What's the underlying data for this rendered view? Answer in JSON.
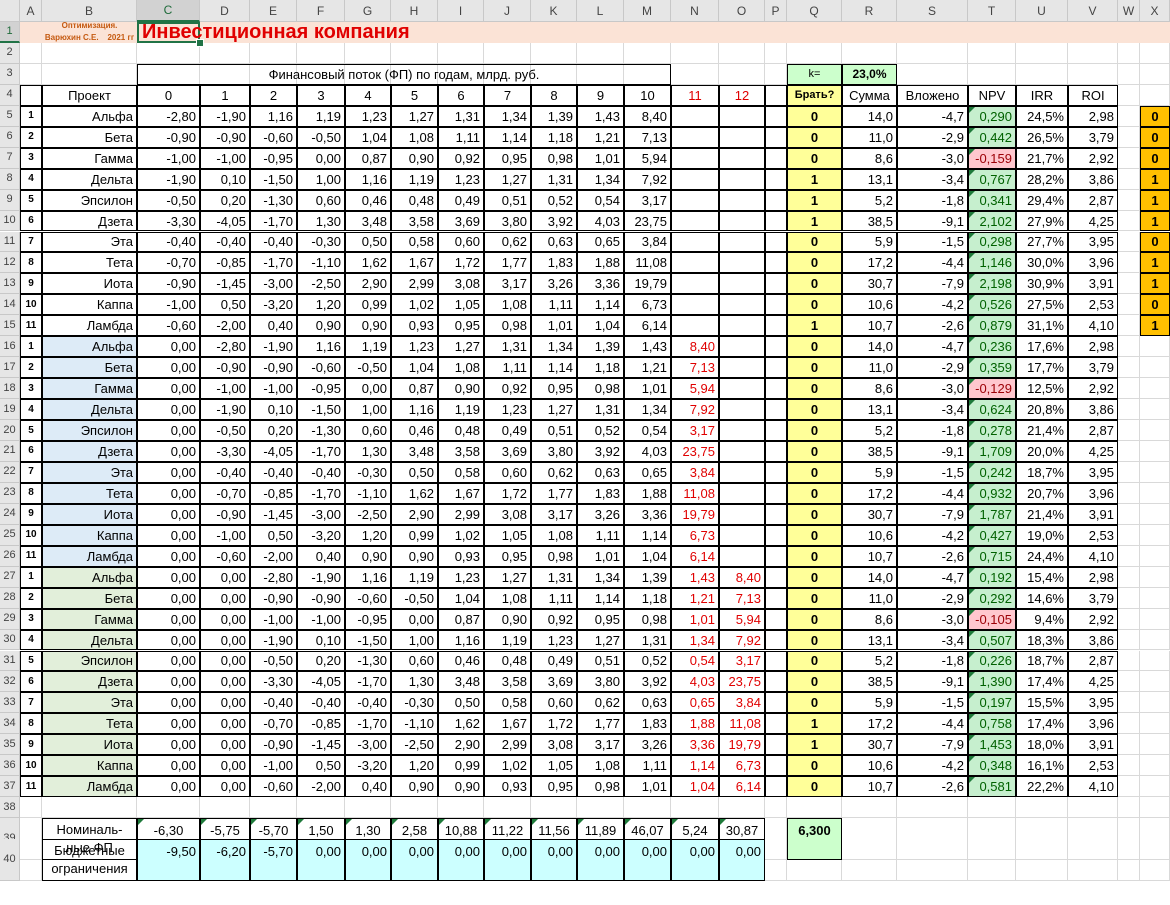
{
  "header": {
    "topleft_line1": "Оптимизация.",
    "topleft_line2": "Варюхин С.Е.    2021 гг",
    "title": "Инвестиционная компания",
    "flow_title": "Финансовый поток (ФП) по годам, млрд. руб.",
    "k_label": "k=",
    "k_value": "23,0%"
  },
  "column_letters": [
    "A",
    "B",
    "C",
    "D",
    "E",
    "F",
    "G",
    "H",
    "I",
    "J",
    "K",
    "L",
    "M",
    "N",
    "O",
    "P",
    "Q",
    "R",
    "S",
    "T",
    "U",
    "V",
    "W",
    "X"
  ],
  "row_numbers": [
    "1",
    "2",
    "3",
    "4",
    "5",
    "6",
    "7",
    "8",
    "9",
    "10",
    "11",
    "12",
    "13",
    "14",
    "15",
    "16",
    "17",
    "18",
    "19",
    "20",
    "21",
    "22",
    "23",
    "24",
    "25",
    "26",
    "27",
    "28",
    "29",
    "30",
    "31",
    "32",
    "33",
    "34",
    "35",
    "36",
    "37",
    "38",
    "39",
    "40"
  ],
  "table_header": {
    "project": "Проект",
    "years": [
      "0",
      "1",
      "2",
      "3",
      "4",
      "5",
      "6",
      "7",
      "8",
      "9",
      "10",
      "11",
      "12"
    ],
    "take": "Брать?",
    "sum": "Сумма",
    "invested": "Вложено",
    "npv": "NPV",
    "irr": "IRR",
    "roi": "ROI"
  },
  "rows": [
    {
      "n": "1",
      "p": "Альфа",
      "v": [
        "-2,80",
        "-1,90",
        "1,16",
        "1,19",
        "1,23",
        "1,27",
        "1,31",
        "1,34",
        "1,39",
        "1,43",
        "8,40",
        "",
        ""
      ],
      "take": "0",
      "sum": "14,0",
      "inv": "-4,7",
      "npv": "0,290",
      "irr": "24,5%",
      "roi": "2,98",
      "x": "0"
    },
    {
      "n": "2",
      "p": "Бета",
      "v": [
        "-0,90",
        "-0,90",
        "-0,60",
        "-0,50",
        "1,04",
        "1,08",
        "1,11",
        "1,14",
        "1,18",
        "1,21",
        "7,13",
        "",
        ""
      ],
      "take": "0",
      "sum": "11,0",
      "inv": "-2,9",
      "npv": "0,442",
      "irr": "26,5%",
      "roi": "3,79",
      "x": "0"
    },
    {
      "n": "3",
      "p": "Гамма",
      "v": [
        "-1,00",
        "-1,00",
        "-0,95",
        "0,00",
        "0,87",
        "0,90",
        "0,92",
        "0,95",
        "0,98",
        "1,01",
        "5,94",
        "",
        ""
      ],
      "take": "0",
      "sum": "8,6",
      "inv": "-3,0",
      "npv": "-0,159",
      "irr": "21,7%",
      "roi": "2,92",
      "x": "0"
    },
    {
      "n": "4",
      "p": "Дельта",
      "v": [
        "-1,90",
        "0,10",
        "-1,50",
        "1,00",
        "1,16",
        "1,19",
        "1,23",
        "1,27",
        "1,31",
        "1,34",
        "7,92",
        "",
        ""
      ],
      "take": "1",
      "sum": "13,1",
      "inv": "-3,4",
      "npv": "0,767",
      "irr": "28,2%",
      "roi": "3,86",
      "x": "1"
    },
    {
      "n": "5",
      "p": "Эпсилон",
      "v": [
        "-0,50",
        "0,20",
        "-1,30",
        "0,60",
        "0,46",
        "0,48",
        "0,49",
        "0,51",
        "0,52",
        "0,54",
        "3,17",
        "",
        ""
      ],
      "take": "1",
      "sum": "5,2",
      "inv": "-1,8",
      "npv": "0,341",
      "irr": "29,4%",
      "roi": "2,87",
      "x": "1"
    },
    {
      "n": "6",
      "p": "Дзета",
      "v": [
        "-3,30",
        "-4,05",
        "-1,70",
        "1,30",
        "3,48",
        "3,58",
        "3,69",
        "3,80",
        "3,92",
        "4,03",
        "23,75",
        "",
        ""
      ],
      "take": "1",
      "sum": "38,5",
      "inv": "-9,1",
      "npv": "2,102",
      "irr": "27,9%",
      "roi": "4,25",
      "x": "1"
    },
    {
      "n": "7",
      "p": "Эта",
      "v": [
        "-0,40",
        "-0,40",
        "-0,40",
        "-0,30",
        "0,50",
        "0,58",
        "0,60",
        "0,62",
        "0,63",
        "0,65",
        "3,84",
        "",
        ""
      ],
      "take": "0",
      "sum": "5,9",
      "inv": "-1,5",
      "npv": "0,298",
      "irr": "27,7%",
      "roi": "3,95",
      "x": "0"
    },
    {
      "n": "8",
      "p": "Тета",
      "v": [
        "-0,70",
        "-0,85",
        "-1,70",
        "-1,10",
        "1,62",
        "1,67",
        "1,72",
        "1,77",
        "1,83",
        "1,88",
        "11,08",
        "",
        ""
      ],
      "take": "0",
      "sum": "17,2",
      "inv": "-4,4",
      "npv": "1,146",
      "irr": "30,0%",
      "roi": "3,96",
      "x": "1"
    },
    {
      "n": "9",
      "p": "Иота",
      "v": [
        "-0,90",
        "-1,45",
        "-3,00",
        "-2,50",
        "2,90",
        "2,99",
        "3,08",
        "3,17",
        "3,26",
        "3,36",
        "19,79",
        "",
        ""
      ],
      "take": "0",
      "sum": "30,7",
      "inv": "-7,9",
      "npv": "2,198",
      "irr": "30,9%",
      "roi": "3,91",
      "x": "1"
    },
    {
      "n": "10",
      "p": "Каппа",
      "v": [
        "-1,00",
        "0,50",
        "-3,20",
        "1,20",
        "0,99",
        "1,02",
        "1,05",
        "1,08",
        "1,11",
        "1,14",
        "6,73",
        "",
        ""
      ],
      "take": "0",
      "sum": "10,6",
      "inv": "-4,2",
      "npv": "0,526",
      "irr": "27,5%",
      "roi": "2,53",
      "x": "0"
    },
    {
      "n": "11",
      "p": "Ламбда",
      "v": [
        "-0,60",
        "-2,00",
        "0,40",
        "0,90",
        "0,90",
        "0,93",
        "0,95",
        "0,98",
        "1,01",
        "1,04",
        "6,14",
        "",
        ""
      ],
      "take": "1",
      "sum": "10,7",
      "inv": "-2,6",
      "npv": "0,879",
      "irr": "31,1%",
      "roi": "4,10",
      "x": "1"
    },
    {
      "n": "1",
      "p": "Альфа",
      "v": [
        "0,00",
        "-2,80",
        "-1,90",
        "1,16",
        "1,19",
        "1,23",
        "1,27",
        "1,31",
        "1,34",
        "1,39",
        "1,43",
        "8,40",
        ""
      ],
      "take": "0",
      "sum": "14,0",
      "inv": "-4,7",
      "npv": "0,236",
      "irr": "17,6%",
      "roi": "2,98"
    },
    {
      "n": "2",
      "p": "Бета",
      "v": [
        "0,00",
        "-0,90",
        "-0,90",
        "-0,60",
        "-0,50",
        "1,04",
        "1,08",
        "1,11",
        "1,14",
        "1,18",
        "1,21",
        "7,13",
        ""
      ],
      "take": "0",
      "sum": "11,0",
      "inv": "-2,9",
      "npv": "0,359",
      "irr": "17,7%",
      "roi": "3,79"
    },
    {
      "n": "3",
      "p": "Гамма",
      "v": [
        "0,00",
        "-1,00",
        "-1,00",
        "-0,95",
        "0,00",
        "0,87",
        "0,90",
        "0,92",
        "0,95",
        "0,98",
        "1,01",
        "5,94",
        ""
      ],
      "take": "0",
      "sum": "8,6",
      "inv": "-3,0",
      "npv": "-0,129",
      "irr": "12,5%",
      "roi": "2,92"
    },
    {
      "n": "4",
      "p": "Дельта",
      "v": [
        "0,00",
        "-1,90",
        "0,10",
        "-1,50",
        "1,00",
        "1,16",
        "1,19",
        "1,23",
        "1,27",
        "1,31",
        "1,34",
        "7,92",
        ""
      ],
      "take": "0",
      "sum": "13,1",
      "inv": "-3,4",
      "npv": "0,624",
      "irr": "20,8%",
      "roi": "3,86"
    },
    {
      "n": "5",
      "p": "Эпсилон",
      "v": [
        "0,00",
        "-0,50",
        "0,20",
        "-1,30",
        "0,60",
        "0,46",
        "0,48",
        "0,49",
        "0,51",
        "0,52",
        "0,54",
        "3,17",
        ""
      ],
      "take": "0",
      "sum": "5,2",
      "inv": "-1,8",
      "npv": "0,278",
      "irr": "21,4%",
      "roi": "2,87"
    },
    {
      "n": "6",
      "p": "Дзета",
      "v": [
        "0,00",
        "-3,30",
        "-4,05",
        "-1,70",
        "1,30",
        "3,48",
        "3,58",
        "3,69",
        "3,80",
        "3,92",
        "4,03",
        "23,75",
        ""
      ],
      "take": "0",
      "sum": "38,5",
      "inv": "-9,1",
      "npv": "1,709",
      "irr": "20,0%",
      "roi": "4,25"
    },
    {
      "n": "7",
      "p": "Эта",
      "v": [
        "0,00",
        "-0,40",
        "-0,40",
        "-0,40",
        "-0,30",
        "0,50",
        "0,58",
        "0,60",
        "0,62",
        "0,63",
        "0,65",
        "3,84",
        ""
      ],
      "take": "0",
      "sum": "5,9",
      "inv": "-1,5",
      "npv": "0,242",
      "irr": "18,7%",
      "roi": "3,95"
    },
    {
      "n": "8",
      "p": "Тета",
      "v": [
        "0,00",
        "-0,70",
        "-0,85",
        "-1,70",
        "-1,10",
        "1,62",
        "1,67",
        "1,72",
        "1,77",
        "1,83",
        "1,88",
        "11,08",
        ""
      ],
      "take": "0",
      "sum": "17,2",
      "inv": "-4,4",
      "npv": "0,932",
      "irr": "20,7%",
      "roi": "3,96"
    },
    {
      "n": "9",
      "p": "Иота",
      "v": [
        "0,00",
        "-0,90",
        "-1,45",
        "-3,00",
        "-2,50",
        "2,90",
        "2,99",
        "3,08",
        "3,17",
        "3,26",
        "3,36",
        "19,79",
        ""
      ],
      "take": "0",
      "sum": "30,7",
      "inv": "-7,9",
      "npv": "1,787",
      "irr": "21,4%",
      "roi": "3,91"
    },
    {
      "n": "10",
      "p": "Каппа",
      "v": [
        "0,00",
        "-1,00",
        "0,50",
        "-3,20",
        "1,20",
        "0,99",
        "1,02",
        "1,05",
        "1,08",
        "1,11",
        "1,14",
        "6,73",
        ""
      ],
      "take": "0",
      "sum": "10,6",
      "inv": "-4,2",
      "npv": "0,427",
      "irr": "19,0%",
      "roi": "2,53"
    },
    {
      "n": "11",
      "p": "Ламбда",
      "v": [
        "0,00",
        "-0,60",
        "-2,00",
        "0,40",
        "0,90",
        "0,90",
        "0,93",
        "0,95",
        "0,98",
        "1,01",
        "1,04",
        "6,14",
        ""
      ],
      "take": "0",
      "sum": "10,7",
      "inv": "-2,6",
      "npv": "0,715",
      "irr": "24,4%",
      "roi": "4,10"
    },
    {
      "n": "1",
      "p": "Альфа",
      "v": [
        "0,00",
        "0,00",
        "-2,80",
        "-1,90",
        "1,16",
        "1,19",
        "1,23",
        "1,27",
        "1,31",
        "1,34",
        "1,39",
        "1,43",
        "8,40"
      ],
      "take": "0",
      "sum": "14,0",
      "inv": "-4,7",
      "npv": "0,192",
      "irr": "15,4%",
      "roi": "2,98"
    },
    {
      "n": "2",
      "p": "Бета",
      "v": [
        "0,00",
        "0,00",
        "-0,90",
        "-0,90",
        "-0,60",
        "-0,50",
        "1,04",
        "1,08",
        "1,11",
        "1,14",
        "1,18",
        "1,21",
        "7,13"
      ],
      "take": "0",
      "sum": "11,0",
      "inv": "-2,9",
      "npv": "0,292",
      "irr": "14,6%",
      "roi": "3,79"
    },
    {
      "n": "3",
      "p": "Гамма",
      "v": [
        "0,00",
        "0,00",
        "-1,00",
        "-1,00",
        "-0,95",
        "0,00",
        "0,87",
        "0,90",
        "0,92",
        "0,95",
        "0,98",
        "1,01",
        "5,94"
      ],
      "take": "0",
      "sum": "8,6",
      "inv": "-3,0",
      "npv": "-0,105",
      "irr": "9,4%",
      "roi": "2,92"
    },
    {
      "n": "4",
      "p": "Дельта",
      "v": [
        "0,00",
        "0,00",
        "-1,90",
        "0,10",
        "-1,50",
        "1,00",
        "1,16",
        "1,19",
        "1,23",
        "1,27",
        "1,31",
        "1,34",
        "7,92"
      ],
      "take": "0",
      "sum": "13,1",
      "inv": "-3,4",
      "npv": "0,507",
      "irr": "18,3%",
      "roi": "3,86"
    },
    {
      "n": "5",
      "p": "Эпсилон",
      "v": [
        "0,00",
        "0,00",
        "-0,50",
        "0,20",
        "-1,30",
        "0,60",
        "0,46",
        "0,48",
        "0,49",
        "0,51",
        "0,52",
        "0,54",
        "3,17"
      ],
      "take": "0",
      "sum": "5,2",
      "inv": "-1,8",
      "npv": "0,226",
      "irr": "18,7%",
      "roi": "2,87"
    },
    {
      "n": "6",
      "p": "Дзета",
      "v": [
        "0,00",
        "0,00",
        "-3,30",
        "-4,05",
        "-1,70",
        "1,30",
        "3,48",
        "3,58",
        "3,69",
        "3,80",
        "3,92",
        "4,03",
        "23,75"
      ],
      "take": "0",
      "sum": "38,5",
      "inv": "-9,1",
      "npv": "1,390",
      "irr": "17,4%",
      "roi": "4,25"
    },
    {
      "n": "7",
      "p": "Эта",
      "v": [
        "0,00",
        "0,00",
        "-0,40",
        "-0,40",
        "-0,40",
        "-0,30",
        "0,50",
        "0,58",
        "0,60",
        "0,62",
        "0,63",
        "0,65",
        "3,84"
      ],
      "take": "0",
      "sum": "5,9",
      "inv": "-1,5",
      "npv": "0,197",
      "irr": "15,5%",
      "roi": "3,95"
    },
    {
      "n": "8",
      "p": "Тета",
      "v": [
        "0,00",
        "0,00",
        "-0,70",
        "-0,85",
        "-1,70",
        "-1,10",
        "1,62",
        "1,67",
        "1,72",
        "1,77",
        "1,83",
        "1,88",
        "11,08"
      ],
      "take": "1",
      "sum": "17,2",
      "inv": "-4,4",
      "npv": "0,758",
      "irr": "17,4%",
      "roi": "3,96"
    },
    {
      "n": "9",
      "p": "Иота",
      "v": [
        "0,00",
        "0,00",
        "-0,90",
        "-1,45",
        "-3,00",
        "-2,50",
        "2,90",
        "2,99",
        "3,08",
        "3,17",
        "3,26",
        "3,36",
        "19,79"
      ],
      "take": "1",
      "sum": "30,7",
      "inv": "-7,9",
      "npv": "1,453",
      "irr": "18,0%",
      "roi": "3,91"
    },
    {
      "n": "10",
      "p": "Каппа",
      "v": [
        "0,00",
        "0,00",
        "-1,00",
        "0,50",
        "-3,20",
        "1,20",
        "0,99",
        "1,02",
        "1,05",
        "1,08",
        "1,11",
        "1,14",
        "6,73"
      ],
      "take": "0",
      "sum": "10,6",
      "inv": "-4,2",
      "npv": "0,348",
      "irr": "16,1%",
      "roi": "2,53"
    },
    {
      "n": "11",
      "p": "Ламбда",
      "v": [
        "0,00",
        "0,00",
        "-0,60",
        "-2,00",
        "0,40",
        "0,90",
        "0,90",
        "0,93",
        "0,95",
        "0,98",
        "1,01",
        "1,04",
        "6,14"
      ],
      "take": "0",
      "sum": "10,7",
      "inv": "-2,6",
      "npv": "0,581",
      "irr": "22,2%",
      "roi": "4,10"
    }
  ],
  "nominal": {
    "label": "Номиналь-ные ФП",
    "values": [
      "-6,30",
      "-5,75",
      "-5,70",
      "1,50",
      "1,30",
      "2,58",
      "10,88",
      "11,22",
      "11,56",
      "11,89",
      "46,07",
      "5,24",
      "30,87"
    ],
    "total": "6,300"
  },
  "budget": {
    "label": "Бюджетные ограничения",
    "values": [
      "-9,50",
      "-6,20",
      "-5,70",
      "0,00",
      "0,00",
      "0,00",
      "0,00",
      "0,00",
      "0,00",
      "0,00",
      "0,00",
      "0,00",
      "0,00"
    ]
  },
  "colors": {
    "title_red": "#e00000",
    "header_peach": "#fbe3d6",
    "yellow": "#ffff99",
    "green_soft": "#ccffcc",
    "npv_green": "#c6efce",
    "npv_red": "#ffc7ce",
    "blue_block": "#ddebf7",
    "green_block": "#e2efda",
    "cyan": "#ccffff",
    "orange": "#ffc000",
    "selection": "#217346"
  }
}
